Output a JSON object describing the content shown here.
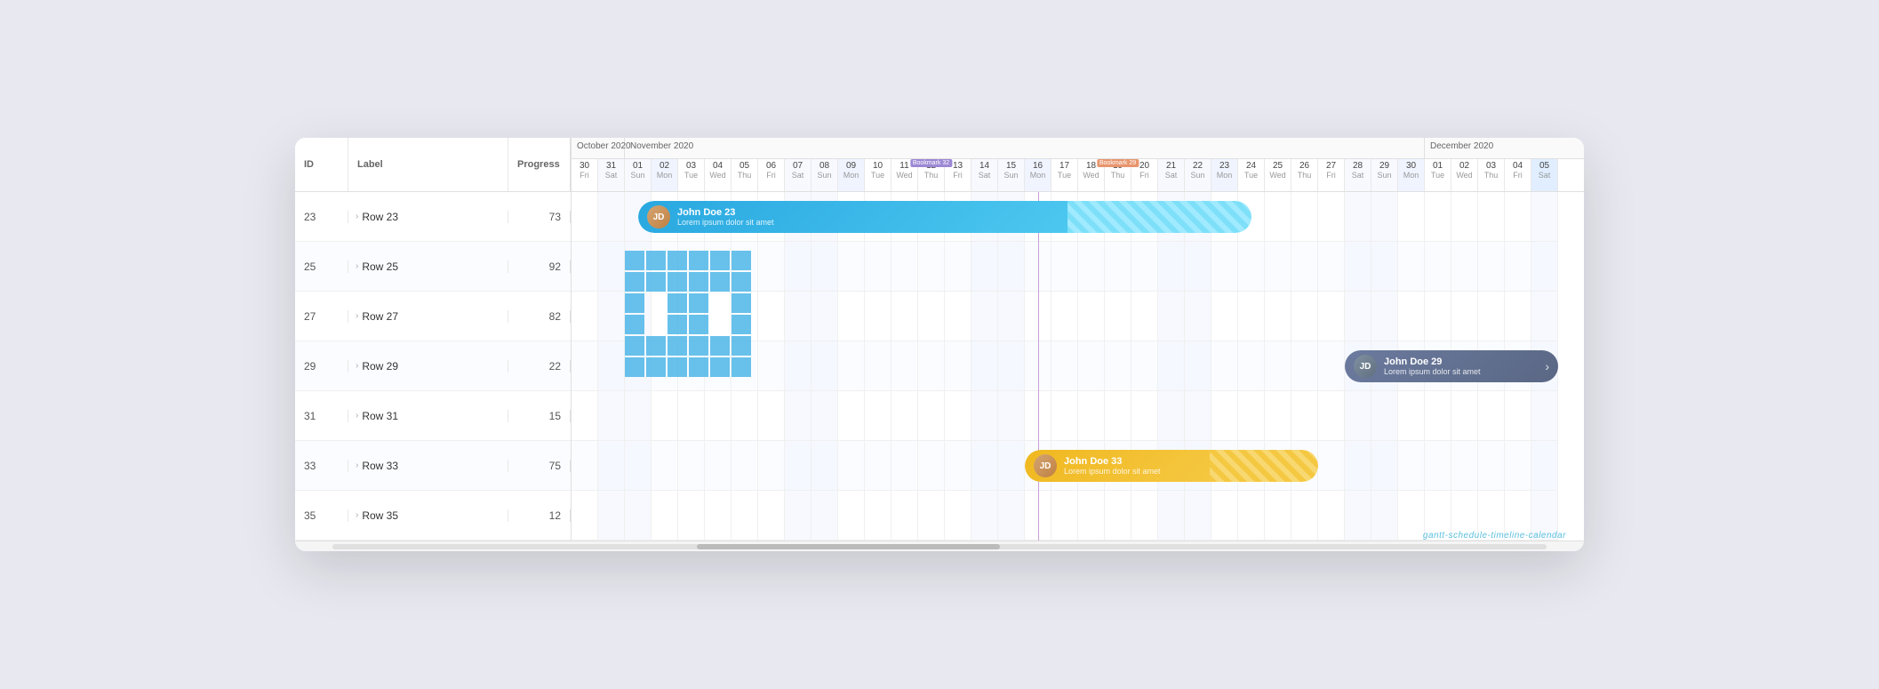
{
  "title": "Gantt Schedule Timeline Calendar",
  "watermark": "gantt-schedule-timeline-calendar",
  "months": [
    {
      "label": "October 2020",
      "span": 2
    },
    {
      "label": "November 2020",
      "span": 30
    },
    {
      "label": "December 2020",
      "span": 10
    }
  ],
  "columns": {
    "id_label": "ID",
    "label_label": "Label",
    "progress_label": "Progress"
  },
  "rows": [
    {
      "id": "23",
      "label": "Row 23",
      "progress": "73"
    },
    {
      "id": "25",
      "label": "Row 25",
      "progress": "92"
    },
    {
      "id": "27",
      "label": "Row 27",
      "progress": "82"
    },
    {
      "id": "29",
      "label": "Row 29",
      "progress": "22"
    },
    {
      "id": "31",
      "label": "Row 31",
      "progress": "15"
    },
    {
      "id": "33",
      "label": "Row 33",
      "progress": "75"
    },
    {
      "id": "35",
      "label": "Row 35",
      "progress": "12"
    }
  ],
  "events": [
    {
      "id": "event-23",
      "title": "John Doe 23",
      "subtitle": "Lorem ipsum dolor sit amet",
      "type": "blue",
      "row": 0,
      "row_action": true
    },
    {
      "id": "event-29",
      "title": "John Doe 29",
      "subtitle": "Lorem ipsum dolor sit amet",
      "type": "gray",
      "row": 3,
      "has_arrow": true
    },
    {
      "id": "event-33",
      "title": "John Doe 33",
      "subtitle": "Lorem ipsum dolor sit amet",
      "type": "orange",
      "row": 5
    }
  ],
  "bookmarks": [
    {
      "label": "Bookmark 32",
      "day_index": 13,
      "color": "purple"
    },
    {
      "label": "Bookmark 29",
      "day_index": 20,
      "color": "orange"
    }
  ],
  "days": [
    {
      "num": "30",
      "name": "Fri",
      "type": "normal"
    },
    {
      "num": "31",
      "name": "Sat",
      "type": "weekend"
    },
    {
      "num": "01",
      "name": "Sun",
      "type": "weekend"
    },
    {
      "num": "02",
      "name": "Mon",
      "type": "mon"
    },
    {
      "num": "03",
      "name": "Tue",
      "type": "normal"
    },
    {
      "num": "04",
      "name": "Wed",
      "type": "normal"
    },
    {
      "num": "05",
      "name": "Thu",
      "type": "normal"
    },
    {
      "num": "06",
      "name": "Fri",
      "type": "normal"
    },
    {
      "num": "07",
      "name": "Sat",
      "type": "weekend"
    },
    {
      "num": "08",
      "name": "Sun",
      "type": "weekend"
    },
    {
      "num": "09",
      "name": "Mon",
      "type": "mon"
    },
    {
      "num": "10",
      "name": "Tue",
      "type": "normal"
    },
    {
      "num": "11",
      "name": "Wed",
      "type": "normal"
    },
    {
      "num": "12",
      "name": "Thu",
      "type": "normal"
    },
    {
      "num": "13",
      "name": "Fri",
      "type": "normal"
    },
    {
      "num": "14",
      "name": "Sat",
      "type": "weekend"
    },
    {
      "num": "15",
      "name": "Sun",
      "type": "weekend"
    },
    {
      "num": "16",
      "name": "Mon",
      "type": "mon"
    },
    {
      "num": "17",
      "name": "Tue",
      "type": "normal"
    },
    {
      "num": "18",
      "name": "Wed",
      "type": "normal"
    },
    {
      "num": "19",
      "name": "Thu",
      "type": "normal"
    },
    {
      "num": "20",
      "name": "Fri",
      "type": "normal"
    },
    {
      "num": "21",
      "name": "Sat",
      "type": "weekend"
    },
    {
      "num": "22",
      "name": "Sun",
      "type": "weekend"
    },
    {
      "num": "23",
      "name": "Mon",
      "type": "mon"
    },
    {
      "num": "24",
      "name": "Tue",
      "type": "normal"
    },
    {
      "num": "25",
      "name": "Wed",
      "type": "normal"
    },
    {
      "num": "26",
      "name": "Thu",
      "type": "normal"
    },
    {
      "num": "27",
      "name": "Fri",
      "type": "normal"
    },
    {
      "num": "28",
      "name": "Sat",
      "type": "weekend"
    },
    {
      "num": "29",
      "name": "Sun",
      "type": "weekend"
    },
    {
      "num": "30",
      "name": "Mon",
      "type": "mon"
    },
    {
      "num": "01",
      "name": "Tue",
      "type": "normal"
    },
    {
      "num": "02",
      "name": "Wed",
      "type": "normal"
    },
    {
      "num": "03",
      "name": "Thu",
      "type": "normal"
    },
    {
      "num": "04",
      "name": "Fri",
      "type": "normal"
    },
    {
      "num": "05",
      "name": "Sat",
      "type": "sat-highlight"
    }
  ]
}
